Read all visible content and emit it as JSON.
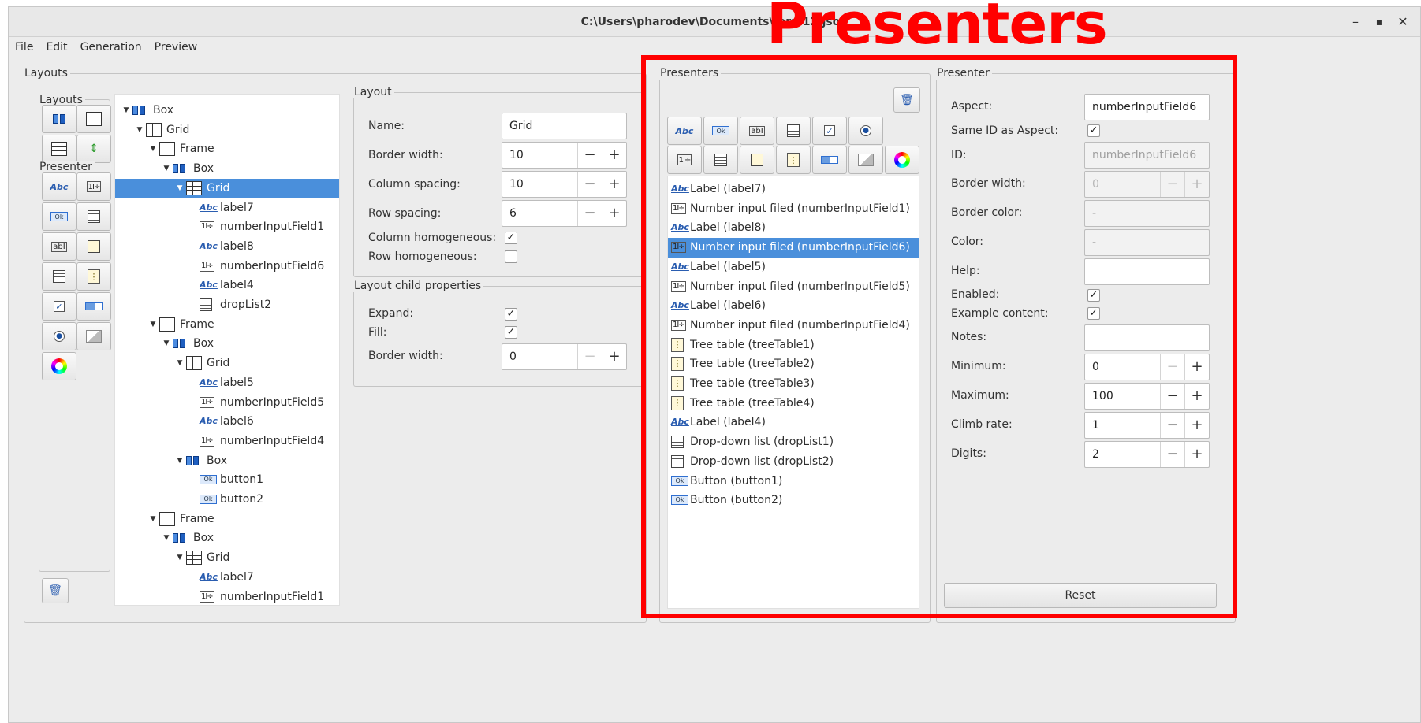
{
  "window": {
    "title": "C:\\Users\\pharodev\\Documents\\form12.json",
    "minimize": "–",
    "maximize": "▪",
    "close": "✕"
  },
  "menu": [
    "File",
    "Edit",
    "Generation",
    "Preview"
  ],
  "annotation": {
    "label": "Presenters",
    "color": "#ff0000"
  },
  "layouts_group": {
    "title": "Layouts",
    "palette_layouts_label": "Layouts",
    "palette_presenter_label": "Presenter",
    "tree": [
      {
        "label": "Box",
        "icon": "box-icon",
        "depth": 0,
        "expanded": true
      },
      {
        "label": "Grid",
        "icon": "grid-icon",
        "depth": 1,
        "expanded": true
      },
      {
        "label": "Frame",
        "icon": "frame-icon",
        "depth": 2,
        "expanded": true
      },
      {
        "label": "Box",
        "icon": "box-icon",
        "depth": 3,
        "expanded": true
      },
      {
        "label": "Grid",
        "icon": "grid-icon",
        "depth": 4,
        "expanded": true,
        "selected": true
      },
      {
        "label": "label7",
        "icon": "label-icon",
        "depth": 5
      },
      {
        "label": "numberInputField1",
        "icon": "number-input-icon",
        "depth": 5
      },
      {
        "label": "label8",
        "icon": "label-icon",
        "depth": 5
      },
      {
        "label": "numberInputField6",
        "icon": "number-input-icon",
        "depth": 5
      },
      {
        "label": "label4",
        "icon": "label-icon",
        "depth": 5
      },
      {
        "label": "dropList2",
        "icon": "drop-list-icon",
        "depth": 5
      },
      {
        "label": "Frame",
        "icon": "frame-icon",
        "depth": 2,
        "expanded": true
      },
      {
        "label": "Box",
        "icon": "box-icon",
        "depth": 3,
        "expanded": true
      },
      {
        "label": "Grid",
        "icon": "grid-icon",
        "depth": 4,
        "expanded": true
      },
      {
        "label": "label5",
        "icon": "label-icon",
        "depth": 5
      },
      {
        "label": "numberInputField5",
        "icon": "number-input-icon",
        "depth": 5
      },
      {
        "label": "label6",
        "icon": "label-icon",
        "depth": 5
      },
      {
        "label": "numberInputField4",
        "icon": "number-input-icon",
        "depth": 5
      },
      {
        "label": "Box",
        "icon": "box-icon",
        "depth": 4,
        "expanded": true
      },
      {
        "label": "button1",
        "icon": "button-icon",
        "depth": 5
      },
      {
        "label": "button2",
        "icon": "button-icon",
        "depth": 5
      },
      {
        "label": "Frame",
        "icon": "frame-icon",
        "depth": 2,
        "expanded": true
      },
      {
        "label": "Box",
        "icon": "box-icon",
        "depth": 3,
        "expanded": true
      },
      {
        "label": "Grid",
        "icon": "grid-icon",
        "depth": 4,
        "expanded": true
      },
      {
        "label": "label7",
        "icon": "label-icon",
        "depth": 5
      },
      {
        "label": "numberInputField1",
        "icon": "number-input-icon",
        "depth": 5
      }
    ]
  },
  "layout_props": {
    "title": "Layout",
    "name_label": "Name:",
    "name_value": "Grid",
    "border_width_label": "Border width:",
    "border_width_value": "10",
    "column_spacing_label": "Column spacing:",
    "column_spacing_value": "10",
    "row_spacing_label": "Row spacing:",
    "row_spacing_value": "6",
    "column_homogeneous_label": "Column homogeneous:",
    "column_homogeneous": true,
    "row_homogeneous_label": "Row homogeneous:",
    "row_homogeneous": false,
    "minus": "−",
    "plus": "+"
  },
  "child_props": {
    "title": "Layout child properties",
    "expand_label": "Expand:",
    "expand": true,
    "fill_label": "Fill:",
    "fill": true,
    "border_width_label": "Border width:",
    "border_width_value": "0"
  },
  "presenters": {
    "title": "Presenters",
    "items": [
      {
        "label": "Label (label7)",
        "icon": "label-icon"
      },
      {
        "label": "Number input filed (numberInputField1)",
        "icon": "number-input-icon"
      },
      {
        "label": "Label (label8)",
        "icon": "label-icon"
      },
      {
        "label": "Number input filed (numberInputField6)",
        "icon": "number-input-icon",
        "selected": true
      },
      {
        "label": "Label (label5)",
        "icon": "label-icon"
      },
      {
        "label": "Number input filed (numberInputField5)",
        "icon": "number-input-icon"
      },
      {
        "label": "Label (label6)",
        "icon": "label-icon"
      },
      {
        "label": "Number input filed (numberInputField4)",
        "icon": "number-input-icon"
      },
      {
        "label": "Tree table (treeTable1)",
        "icon": "tree-table-icon"
      },
      {
        "label": "Tree table (treeTable2)",
        "icon": "tree-table-icon"
      },
      {
        "label": "Tree table (treeTable3)",
        "icon": "tree-table-icon"
      },
      {
        "label": "Tree table (treeTable4)",
        "icon": "tree-table-icon"
      },
      {
        "label": "Label (label4)",
        "icon": "label-icon"
      },
      {
        "label": "Drop-down list (dropList1)",
        "icon": "drop-list-icon"
      },
      {
        "label": "Drop-down list (dropList2)",
        "icon": "drop-list-icon"
      },
      {
        "label": "Button (button1)",
        "icon": "button-icon"
      },
      {
        "label": "Button (button2)",
        "icon": "button-icon"
      }
    ]
  },
  "presenter": {
    "title": "Presenter",
    "aspect_label": "Aspect:",
    "aspect_value": "numberInputField6",
    "same_id_label": "Same ID as Aspect:",
    "same_id": true,
    "id_label": "ID:",
    "id_value": "numberInputField6",
    "border_width_label": "Border width:",
    "border_width_value": "0",
    "border_color_label": "Border color:",
    "border_color_value": "-",
    "color_label": "Color:",
    "color_value": "-",
    "help_label": "Help:",
    "help_value": "",
    "enabled_label": "Enabled:",
    "enabled": true,
    "example_content_label": "Example content:",
    "example_content": true,
    "notes_label": "Notes:",
    "notes_value": "",
    "minimum_label": "Minimum:",
    "minimum_value": "0",
    "maximum_label": "Maximum:",
    "maximum_value": "100",
    "climb_rate_label": "Climb rate:",
    "climb_rate_value": "1",
    "digits_label": "Digits:",
    "digits_value": "2",
    "reset_label": "Reset"
  },
  "colors": {
    "selection": "#4a8fdb",
    "annotation": "#ff0000"
  }
}
